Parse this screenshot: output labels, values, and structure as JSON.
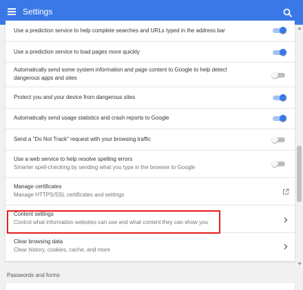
{
  "app": {
    "title": "Settings"
  },
  "rows": [
    {
      "primary": "Use a prediction service to help complete searches and URLs typed in the address bar",
      "toggle": "on"
    },
    {
      "primary": "Use a prediction service to load pages more quickly",
      "toggle": "on"
    },
    {
      "primary": "Automatically send some system information and page content to Google to help detect dangerous apps and sites",
      "toggle": "off"
    },
    {
      "primary": "Protect you and your device from dangerous sites",
      "toggle": "on"
    },
    {
      "primary": "Automatically send usage statistics and crash reports to Google",
      "toggle": "on"
    },
    {
      "primary": "Send a \"Do Not Track\" request with your browsing traffic",
      "toggle": "off"
    },
    {
      "primary": "Use a web service to help resolve spelling errors",
      "secondary": "Smarter spell-checking by sending what you type in the browser to Google",
      "toggle": "off"
    },
    {
      "primary": "Manage certificates",
      "secondary": "Manage HTTPS/SSL certificates and settings",
      "action": "external-link"
    },
    {
      "primary": "Content settings",
      "secondary": "Control what information websites can use and what content they can show you",
      "action": "chevron"
    },
    {
      "primary": "Clear browsing data",
      "secondary": "Clear history, cookies, cache, and more",
      "action": "chevron"
    }
  ],
  "sections": {
    "next_heading": "Passwords and forms"
  },
  "colors": {
    "accent": "#3b78e7",
    "highlight": "#e31b1b"
  },
  "icons": {
    "menu": "menu-icon",
    "search": "search-icon",
    "external": "open-in-new-icon",
    "chevron": "chevron-right-icon"
  }
}
